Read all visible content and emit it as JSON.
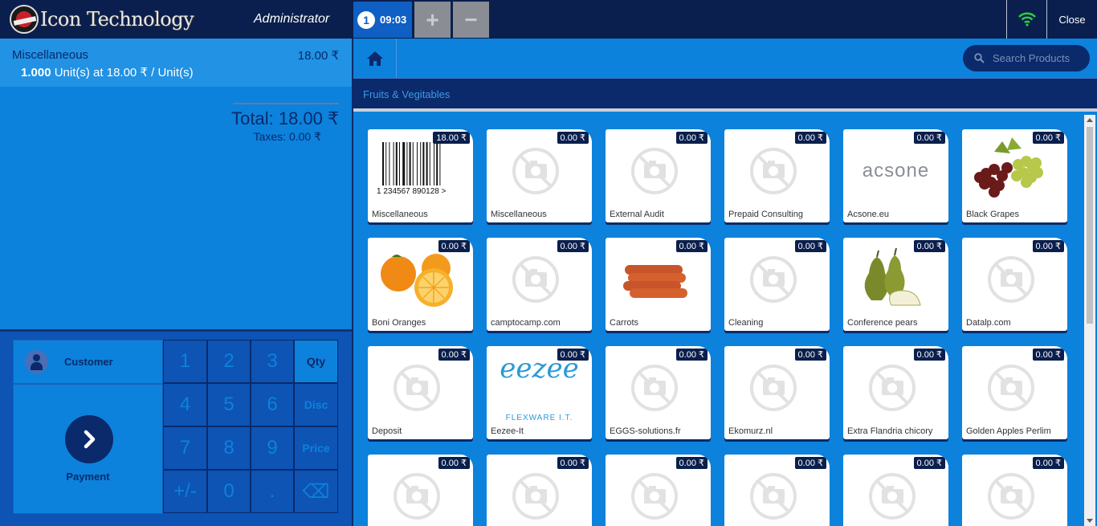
{
  "header": {
    "logo_text": "Icon Technology",
    "user": "Administrator",
    "order_number": "1",
    "order_time": "09:03",
    "add_label": "+",
    "remove_label": "−",
    "close_label": "Close"
  },
  "order": {
    "line": {
      "product": "Miscellaneous",
      "price": "18.00 ₹",
      "quantity": "1.000",
      "detail": " Unit(s) at 18.00 ₹ / Unit(s)"
    },
    "total": "Total: 18.00 ₹",
    "taxes": "Taxes: 0.00 ₹"
  },
  "controls": {
    "customer_label": "Customer",
    "payment_label": "Payment",
    "numpad": [
      "1",
      "2",
      "3",
      "Qty",
      "4",
      "5",
      "6",
      "Disc",
      "7",
      "8",
      "9",
      "Price",
      "+/-",
      "0",
      ".",
      "⌫"
    ],
    "active_mode": "Qty"
  },
  "search": {
    "placeholder": "Search Products"
  },
  "breadcrumb": "Fruits & Vegitables",
  "products": [
    {
      "name": "Miscellaneous",
      "price": "18.00 ₹",
      "image": "barcode"
    },
    {
      "name": "Miscellaneous",
      "price": "0.00 ₹",
      "image": "placeholder"
    },
    {
      "name": "External Audit",
      "price": "0.00 ₹",
      "image": "placeholder"
    },
    {
      "name": "Prepaid Consulting",
      "price": "0.00 ₹",
      "image": "placeholder"
    },
    {
      "name": "Acsone.eu",
      "price": "0.00 ₹",
      "image": "acsone-logo",
      "logo_text": "acsone"
    },
    {
      "name": "Black Grapes",
      "price": "0.00 ₹",
      "image": "grapes"
    },
    {
      "name": "Boni Oranges",
      "price": "0.00 ₹",
      "image": "oranges"
    },
    {
      "name": "camptocamp.com",
      "price": "0.00 ₹",
      "image": "placeholder"
    },
    {
      "name": "Carrots",
      "price": "0.00 ₹",
      "image": "carrots"
    },
    {
      "name": "Cleaning",
      "price": "0.00 ₹",
      "image": "placeholder"
    },
    {
      "name": "Conference pears",
      "price": "0.00 ₹",
      "image": "pears"
    },
    {
      "name": "Datalp.com",
      "price": "0.00 ₹",
      "image": "placeholder"
    },
    {
      "name": "Deposit",
      "price": "0.00 ₹",
      "image": "placeholder"
    },
    {
      "name": "Eezee-It",
      "price": "0.00 ₹",
      "image": "eezee-logo",
      "logo_text": "eezee",
      "logo_subtext": "FLEXWARE I.T."
    },
    {
      "name": "EGGS-solutions.fr",
      "price": "0.00 ₹",
      "image": "placeholder"
    },
    {
      "name": "Ekomurz.nl",
      "price": "0.00 ₹",
      "image": "placeholder"
    },
    {
      "name": "Extra Flandria chicory",
      "price": "0.00 ₹",
      "image": "placeholder"
    },
    {
      "name": "Golden Apples Perlim",
      "price": "0.00 ₹",
      "image": "placeholder"
    },
    {
      "name": "",
      "price": "0.00 ₹",
      "image": "placeholder"
    },
    {
      "name": "",
      "price": "0.00 ₹",
      "image": "placeholder"
    },
    {
      "name": "",
      "price": "0.00 ₹",
      "image": "placeholder"
    },
    {
      "name": "",
      "price": "0.00 ₹",
      "image": "placeholder"
    },
    {
      "name": "",
      "price": "0.00 ₹",
      "image": "placeholder"
    },
    {
      "name": "",
      "price": "0.00 ₹",
      "image": "placeholder"
    }
  ],
  "barcode_digits": "1 234567 890128 >",
  "colors": {
    "header": "#0a1f4d",
    "panel_blue": "#0c82dc",
    "navy": "#0a2a6b",
    "wifi": "#2ecc40"
  }
}
